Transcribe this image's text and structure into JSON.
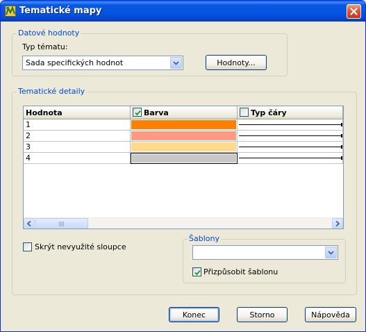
{
  "window": {
    "title": "Tematické mapy",
    "icons": {
      "app": "thematic-map-app-icon",
      "close": "close-icon"
    },
    "colors": {
      "titlebar": "#0554e3",
      "close": "#e2583b"
    }
  },
  "datove_hodnoty": {
    "legend": "Datové hodnoty",
    "typ_label": "Typ tématu:",
    "typ_value": "Sada specifických hodnot",
    "hodnoty_button": "Hodnoty..."
  },
  "tematicke_detaily": {
    "legend": "Tematické detaily",
    "columns": [
      {
        "label": "Hodnota",
        "checkbox": false
      },
      {
        "label": "Barva",
        "checkbox": true,
        "checked": true
      },
      {
        "label": "Typ čáry",
        "checkbox": true,
        "checked": false
      }
    ],
    "rows": [
      {
        "value": "1",
        "color": "#ff8000",
        "line": "solid"
      },
      {
        "value": "2",
        "color": "#ff9980",
        "line": "solid"
      },
      {
        "value": "3",
        "color": "#ffd98c",
        "line": "solid"
      },
      {
        "value": "4",
        "color": "#c8c8c8",
        "line": "solid"
      }
    ],
    "scrollbar": {
      "left_icon": "scroll-left-icon",
      "right_icon": "scroll-right-icon",
      "grip_icon": "scroll-grip-icon"
    },
    "skryt_label": "Skrýt nevyužité sloupce",
    "skryt_checked": false,
    "sablony": {
      "legend": "Šablony",
      "value": "",
      "prizpusobit_label": "Přizpůsobit šablonu",
      "prizpusobit_checked": true
    }
  },
  "buttons": {
    "konec": "Konec",
    "storno": "Storno",
    "napoveda": "Nápověda"
  }
}
